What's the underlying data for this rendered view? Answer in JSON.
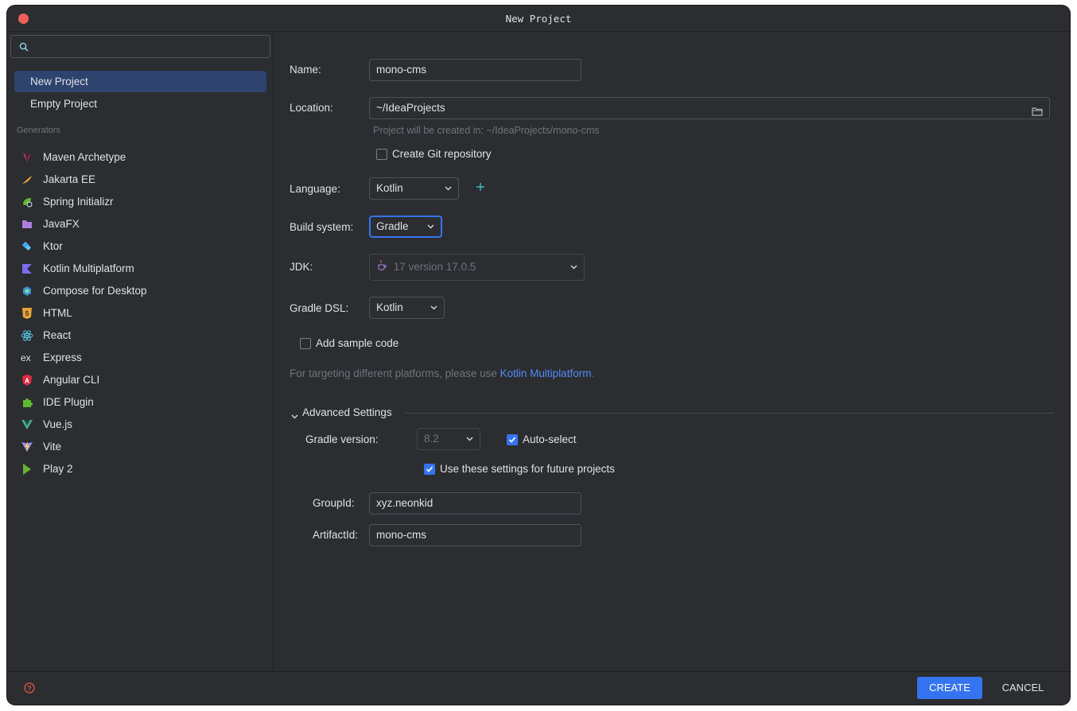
{
  "window": {
    "title": "New Project"
  },
  "sidebar": {
    "search": {
      "placeholder": ""
    },
    "items": [
      {
        "label": "New Project",
        "selected": true
      },
      {
        "label": "Empty Project",
        "selected": false
      }
    ],
    "generators_label": "Generators",
    "generators": [
      {
        "label": "Maven Archetype",
        "icon": "maven-icon"
      },
      {
        "label": "Jakarta EE",
        "icon": "jakarta-icon"
      },
      {
        "label": "Spring Initializr",
        "icon": "spring-icon"
      },
      {
        "label": "JavaFX",
        "icon": "javafx-icon"
      },
      {
        "label": "Ktor",
        "icon": "ktor-icon"
      },
      {
        "label": "Kotlin Multiplatform",
        "icon": "kotlin-icon"
      },
      {
        "label": "Compose for Desktop",
        "icon": "compose-icon"
      },
      {
        "label": "HTML",
        "icon": "html5-icon"
      },
      {
        "label": "React",
        "icon": "react-icon"
      },
      {
        "label": "Express",
        "icon": "express-icon"
      },
      {
        "label": "Angular CLI",
        "icon": "angular-icon"
      },
      {
        "label": "IDE Plugin",
        "icon": "plugin-icon"
      },
      {
        "label": "Vue.js",
        "icon": "vue-icon"
      },
      {
        "label": "Vite",
        "icon": "vite-icon"
      },
      {
        "label": "Play 2",
        "icon": "play-icon"
      }
    ]
  },
  "form": {
    "name": {
      "label": "Name:",
      "value": "mono-cms"
    },
    "location": {
      "label": "Location:",
      "value": "~/IdeaProjects",
      "hint": "Project will be created in: ~/IdeaProjects/mono-cms"
    },
    "git": {
      "label": "Create Git repository",
      "checked": false
    },
    "language": {
      "label": "Language:",
      "value": "Kotlin"
    },
    "build_system": {
      "label": "Build system:",
      "value": "Gradle"
    },
    "jdk": {
      "label": "JDK:",
      "value": "17 version 17.0.5"
    },
    "gradle_dsl": {
      "label": "Gradle DSL:",
      "value": "Kotlin"
    },
    "sample_code": {
      "label": "Add sample code",
      "checked": false
    },
    "multiplatform_note": {
      "prefix": "For targeting different platforms, please use ",
      "link": "Kotlin Multiplatform",
      "suffix": "."
    },
    "advanced": {
      "title": "Advanced Settings",
      "gradle_version": {
        "label": "Gradle version:",
        "value": "8.2"
      },
      "auto_select": {
        "label": "Auto-select",
        "checked": true
      },
      "future_projects": {
        "label": "Use these settings for future projects",
        "checked": true
      },
      "group_id": {
        "label": "GroupId:",
        "value": "xyz.neonkid"
      },
      "artifact_id": {
        "label": "ArtifactId:",
        "value": "mono-cms"
      }
    }
  },
  "footer": {
    "create_label": "CREATE",
    "cancel_label": "CANCEL"
  },
  "colors": {
    "accent": "#3574f0",
    "background": "#2b2d30",
    "selection": "#2e436e",
    "link": "#548af7"
  }
}
